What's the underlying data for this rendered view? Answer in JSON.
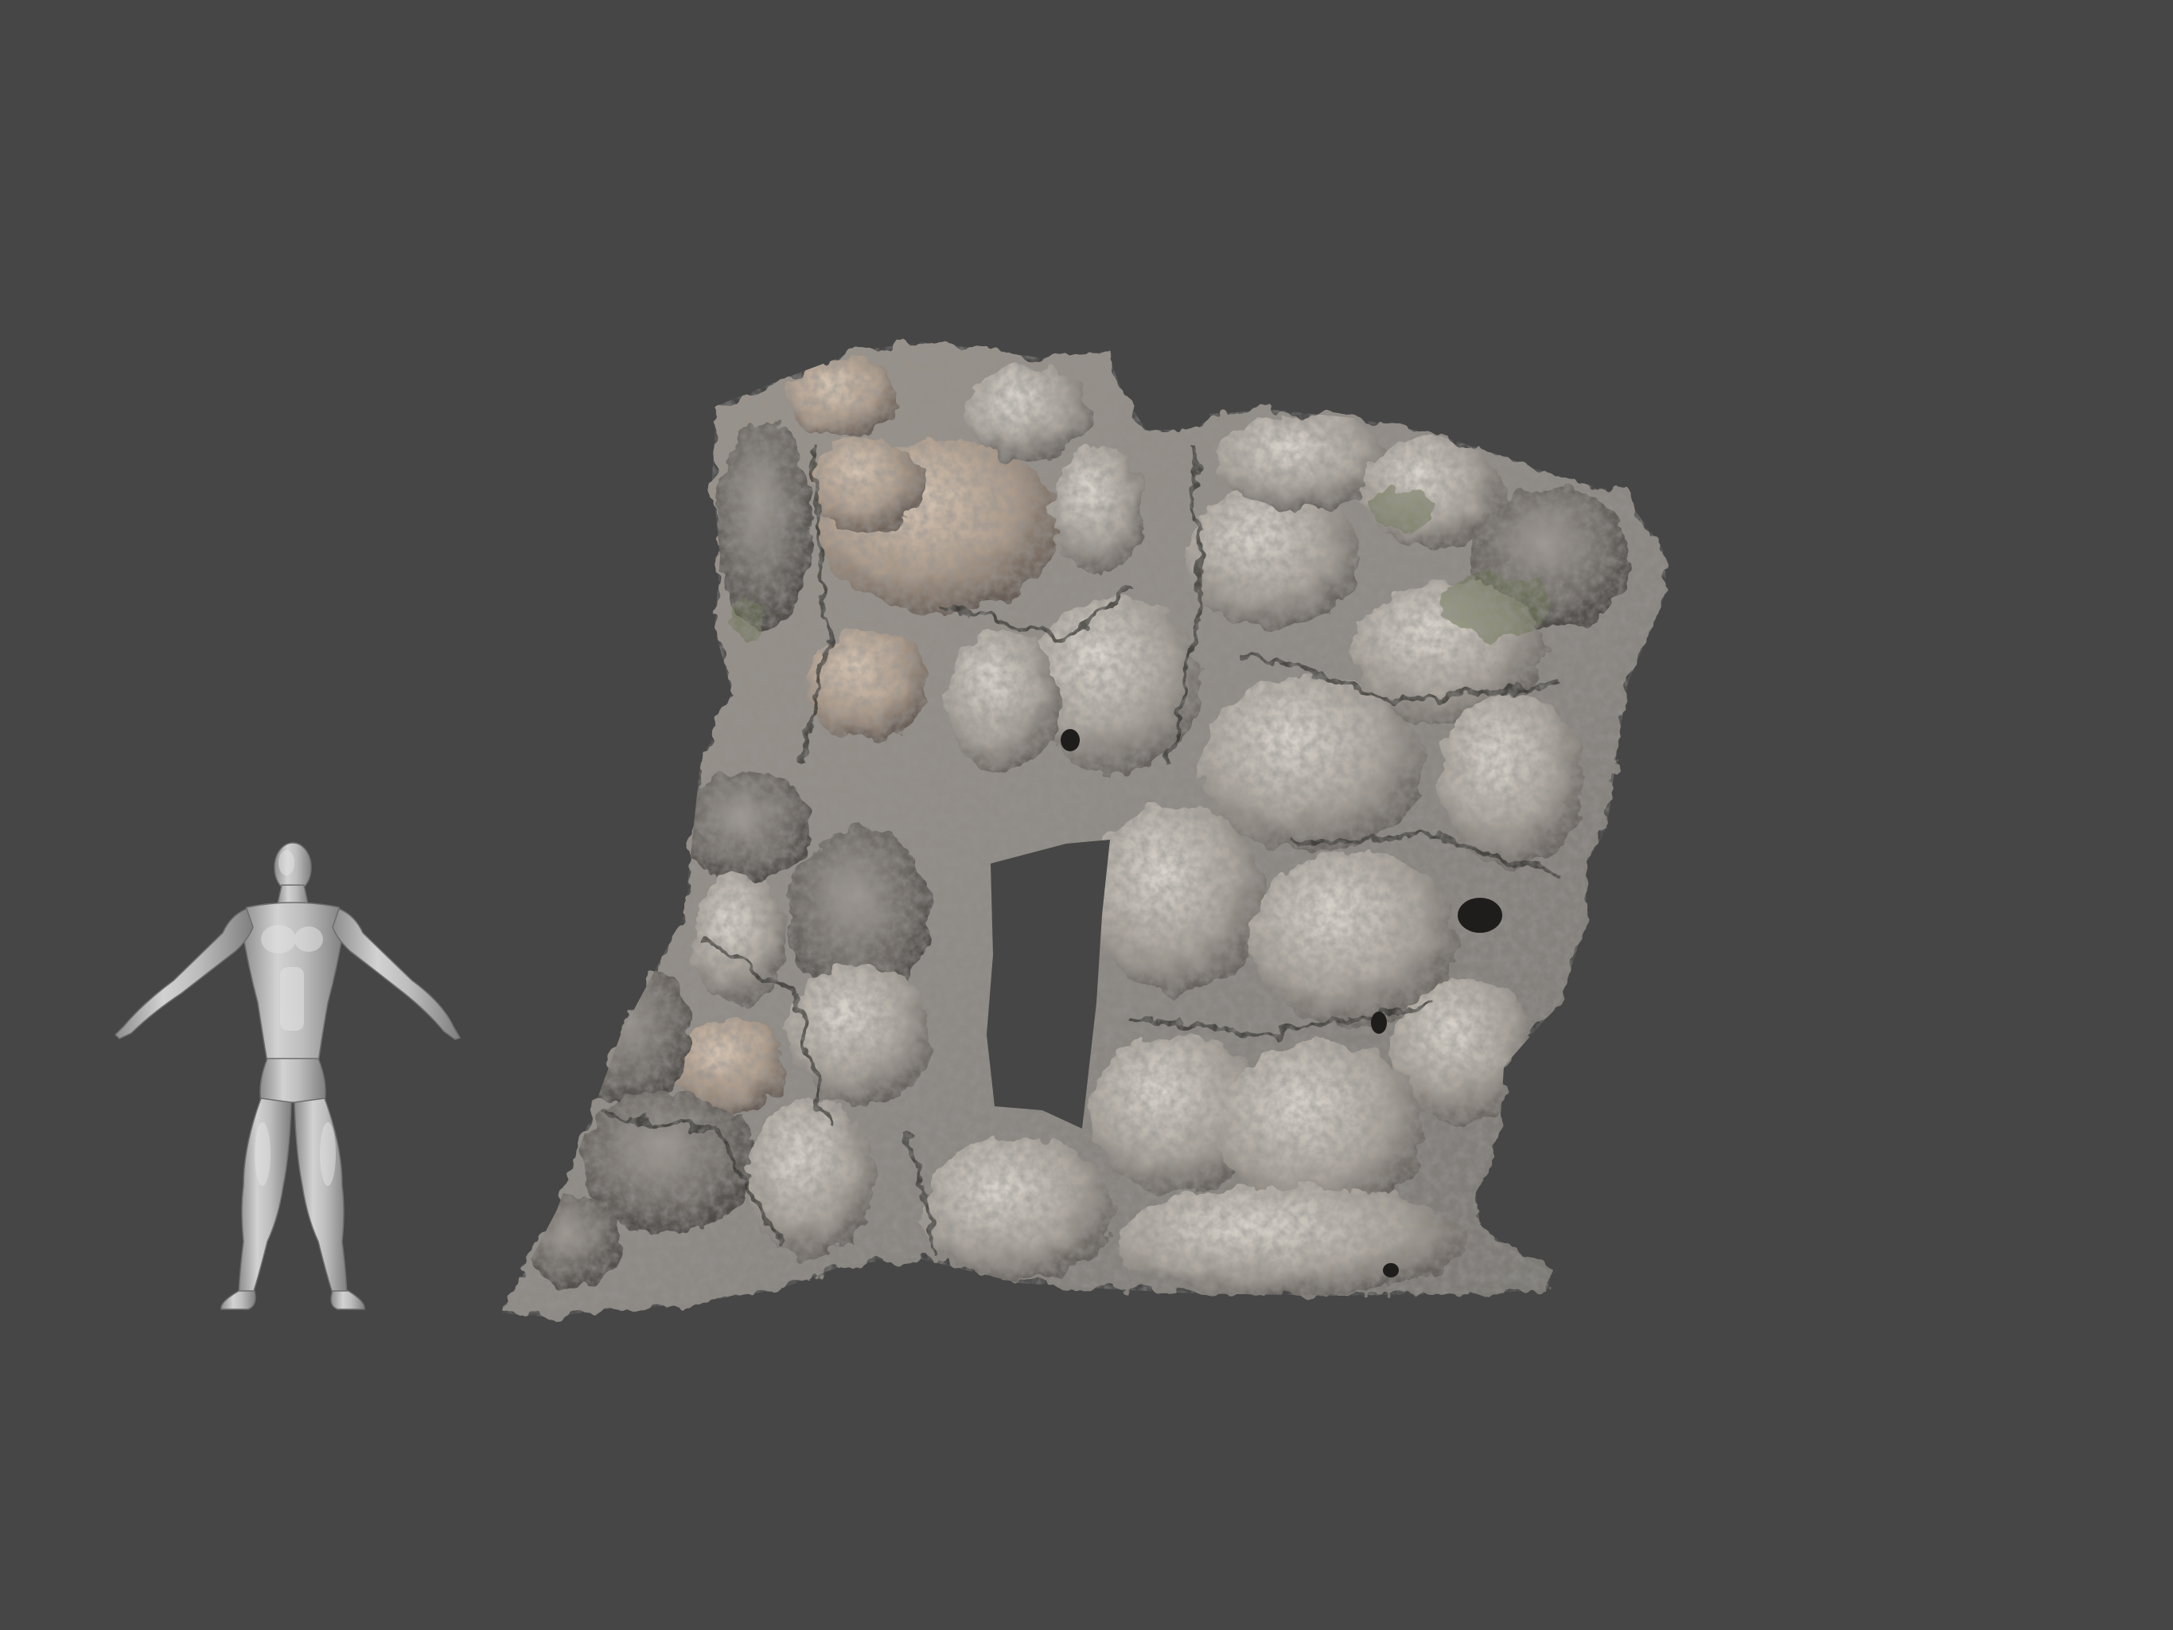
{
  "viewport": {
    "background_color": "#464646"
  },
  "scale_figure": {
    "description_icon": "human-figure-icon",
    "color": "#b9b9b9"
  },
  "rock_model": {
    "icon": "rock-arch-icon",
    "colors": {
      "base": "#8e8a85",
      "light": "#c9c4bd",
      "dark": "#3e3b38",
      "warm": "#a89a8c",
      "moss": "#6f7a55"
    }
  }
}
